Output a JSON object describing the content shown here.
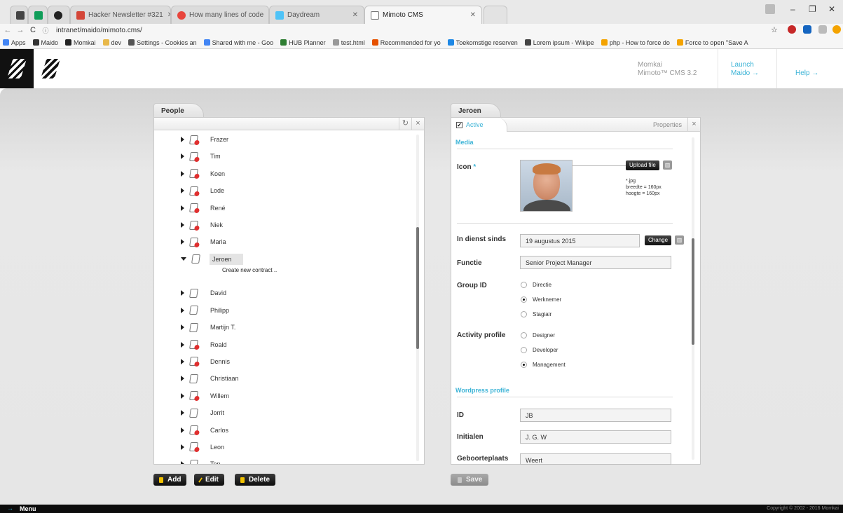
{
  "browser": {
    "tabs": [
      {
        "label": "",
        "color": "#444444"
      },
      {
        "label": "",
        "color": "#0f9d58"
      },
      {
        "label": "",
        "color": "#222222"
      },
      {
        "label": "Hacker Newsletter #321",
        "color": "#d44638"
      },
      {
        "label": "How many lines of code",
        "color": "#e8453c"
      },
      {
        "label": "Daydream",
        "color": "#4fc3f7"
      },
      {
        "label": "Mimoto CMS",
        "color": "#777777"
      }
    ],
    "url": "intranet/maido/mimoto.cms/",
    "bookmarks": [
      {
        "label": "Apps",
        "color": "#4285f4"
      },
      {
        "label": "Maido",
        "color": "#333333"
      },
      {
        "label": "Momkai",
        "color": "#222222"
      },
      {
        "label": "dev",
        "color": "#e8b84a"
      },
      {
        "label": "Settings - Cookies an",
        "color": "#555555"
      },
      {
        "label": "Shared with me - Goo",
        "color": "#4285f4"
      },
      {
        "label": "HUB Planner",
        "color": "#2e7d32"
      },
      {
        "label": "test.html",
        "color": "#999999"
      },
      {
        "label": "Recommended for yo",
        "color": "#e65100"
      },
      {
        "label": "Toekomstige reserven",
        "color": "#1e88e5"
      },
      {
        "label": "Lorem ipsum - Wikipe",
        "color": "#444444"
      },
      {
        "label": "php - How to force do",
        "color": "#f4a300"
      },
      {
        "label": "Force to open \"Save A",
        "color": "#f4a300"
      }
    ]
  },
  "header": {
    "brand_line1": "Momkai",
    "brand_line2": "Mimoto™ CMS 3.2",
    "launch_line1": "Launch",
    "launch_line2": "Maido  →",
    "help": "Help  →"
  },
  "people_panel": {
    "title": "People",
    "refresh_icon": "↻",
    "close_icon": "×",
    "context_item": "Create new contract ..",
    "items": [
      {
        "name": "Frazer",
        "state": "alert"
      },
      {
        "name": "Tim",
        "state": "alert"
      },
      {
        "name": "Koen",
        "state": "alert"
      },
      {
        "name": "Lode",
        "state": "alert"
      },
      {
        "name": "René",
        "state": "alert"
      },
      {
        "name": "Niek",
        "state": "alert"
      },
      {
        "name": "Maria",
        "state": "alert"
      },
      {
        "name": "Jeroen",
        "state": "open"
      },
      {
        "name": "David",
        "state": "plain"
      },
      {
        "name": "Philipp",
        "state": "plain"
      },
      {
        "name": "Martijn T.",
        "state": "plain"
      },
      {
        "name": "Roald",
        "state": "alert"
      },
      {
        "name": "Dennis",
        "state": "alert"
      },
      {
        "name": "Christiaan",
        "state": "plain"
      },
      {
        "name": "Willem",
        "state": "alert"
      },
      {
        "name": "Jorrit",
        "state": "plain"
      },
      {
        "name": "Carlos",
        "state": "alert"
      },
      {
        "name": "Leon",
        "state": "alert"
      },
      {
        "name": "Ton",
        "state": "plain"
      }
    ],
    "buttons": {
      "add": "Add",
      "edit": "Edit",
      "delete": "Delete"
    }
  },
  "detail_panel": {
    "title": "Jeroen",
    "active_label": "Active",
    "active_checked": "✔",
    "properties_label": "Properties",
    "close_icon": "×",
    "media_section": "Media",
    "icon_label": "Icon",
    "required_mark": "*",
    "upload_button": "Upload file",
    "icon_hint": [
      "*.jpg",
      "breedte = 160px",
      "hoogte = 160px"
    ],
    "in_dienst_label": "In dienst sinds",
    "in_dienst_value": "19 augustus 2015",
    "change_button": "Change",
    "functie_label": "Functie",
    "functie_value": "Senior Project Manager",
    "group_label": "Group ID",
    "group_options": [
      {
        "label": "Directie",
        "selected": false
      },
      {
        "label": "Werknemer",
        "selected": true
      },
      {
        "label": "Stagiair",
        "selected": false
      }
    ],
    "activity_label": "Activity profile",
    "activity_options": [
      {
        "label": "Designer",
        "selected": false
      },
      {
        "label": "Developer",
        "selected": false
      },
      {
        "label": "Management",
        "selected": true
      }
    ],
    "wordpress_section": "Wordpress profile",
    "id_label": "ID",
    "id_value": "JB",
    "initialen_label": "Initialen",
    "initialen_value": "J. G. W",
    "geboorteplaats_label": "Geboorteplaats",
    "geboorteplaats_value": "Weert",
    "save_button": "Save"
  },
  "footer": {
    "menu": "Menu",
    "copyright": "Copyright © 2002 - 2016 Momkai"
  },
  "colors": {
    "accent": "#3bb3d6",
    "alert": "#e03030",
    "button_icon": "#f2c200"
  }
}
